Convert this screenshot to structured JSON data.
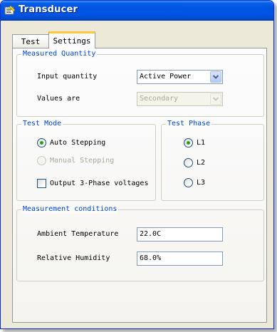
{
  "window": {
    "title": "Transducer"
  },
  "tabs": [
    {
      "label": "Test",
      "selected": false
    },
    {
      "label": "Settings",
      "selected": true
    }
  ],
  "measured_quantity": {
    "title": "Measured Quantity",
    "input_quantity_label": "Input quantity",
    "input_quantity_value": "Active Power",
    "values_are_label": "Values are",
    "values_are_value": "Secondary",
    "values_are_enabled": false
  },
  "test_mode": {
    "title": "Test Mode",
    "auto_stepping_label": "Auto Stepping",
    "auto_stepping_selected": true,
    "manual_stepping_label": "Manual Stepping",
    "manual_stepping_enabled": false,
    "output_3phase_label": "Output 3-Phase voltages",
    "output_3phase_checked": false
  },
  "test_phase": {
    "title": "Test Phase",
    "options": [
      {
        "label": "L1",
        "selected": true
      },
      {
        "label": "L2",
        "selected": false
      },
      {
        "label": "L3",
        "selected": false
      }
    ]
  },
  "measurement_conditions": {
    "title": "Measurement conditions",
    "ambient_temperature_label": "Ambient Temperature",
    "ambient_temperature_value": "22.0C",
    "relative_humidity_label": "Relative Humidity",
    "relative_humidity_value": "68.0%"
  },
  "colors": {
    "group_title": "#0046d5",
    "titlebar": "#0054e3",
    "radio_selected": "#21a121",
    "tab_highlight": "#ffc83c"
  }
}
